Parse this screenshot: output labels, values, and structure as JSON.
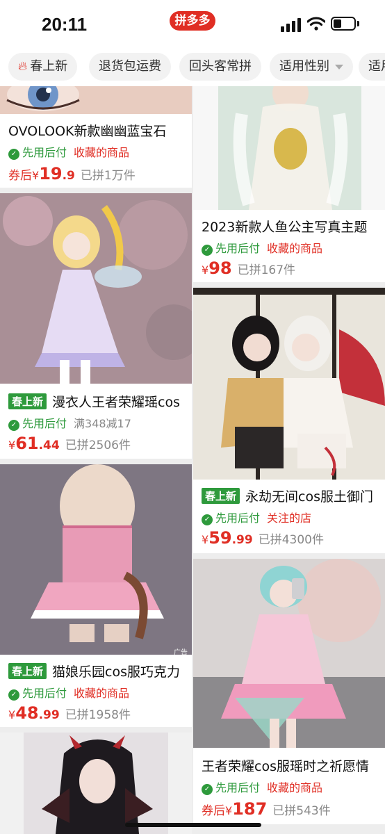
{
  "status_bar": {
    "time": "20:11",
    "app_label": "拼多多"
  },
  "filters": [
    "春上新",
    "退货包运费",
    "回头客常拼",
    "适用性别",
    "适用"
  ],
  "products": [
    {
      "title": "OVOLOOK新款幽幽蓝宝石",
      "badge": "",
      "pay": "先用后付",
      "tag": "收藏的商品",
      "price_prefix": "券后",
      "currency": "¥",
      "price_int": "19",
      "price_dec": ".9",
      "sold": "已拼1万件"
    },
    {
      "title": "2023新款人鱼公主写真主题",
      "badge": "",
      "pay": "先用后付",
      "tag": "收藏的商品",
      "price_prefix": "",
      "currency": "¥",
      "price_int": "98",
      "price_dec": "",
      "sold": "已拼167件"
    },
    {
      "title": "漫衣人王者荣耀瑶cos",
      "badge": "春上新",
      "pay": "先用后付",
      "tag": "满348减17",
      "price_prefix": "",
      "currency": "¥",
      "price_int": "61",
      "price_dec": ".44",
      "sold": "已拼2506件"
    },
    {
      "title": "永劫无间cos服土御门",
      "badge": "春上新",
      "pay": "先用后付",
      "tag": "关注的店",
      "price_prefix": "",
      "currency": "¥",
      "price_int": "59",
      "price_dec": ".99",
      "sold": "已拼4300件"
    },
    {
      "title": "猫娘乐园cos服巧克力",
      "badge": "春上新",
      "pay": "先用后付",
      "tag": "收藏的商品",
      "price_prefix": "",
      "currency": "¥",
      "price_int": "48",
      "price_dec": ".99",
      "sold": "已拼1958件",
      "ad": "广告"
    },
    {
      "title": "王者荣耀cos服瑶时之祈愿情",
      "badge": "",
      "pay": "先用后付",
      "tag": "收藏的商品",
      "price_prefix": "券后",
      "currency": "¥",
      "price_int": "187",
      "price_dec": "",
      "sold": "已拼543件"
    }
  ],
  "colors": {
    "brand": "#e02e24",
    "green": "#2e9a3c"
  }
}
